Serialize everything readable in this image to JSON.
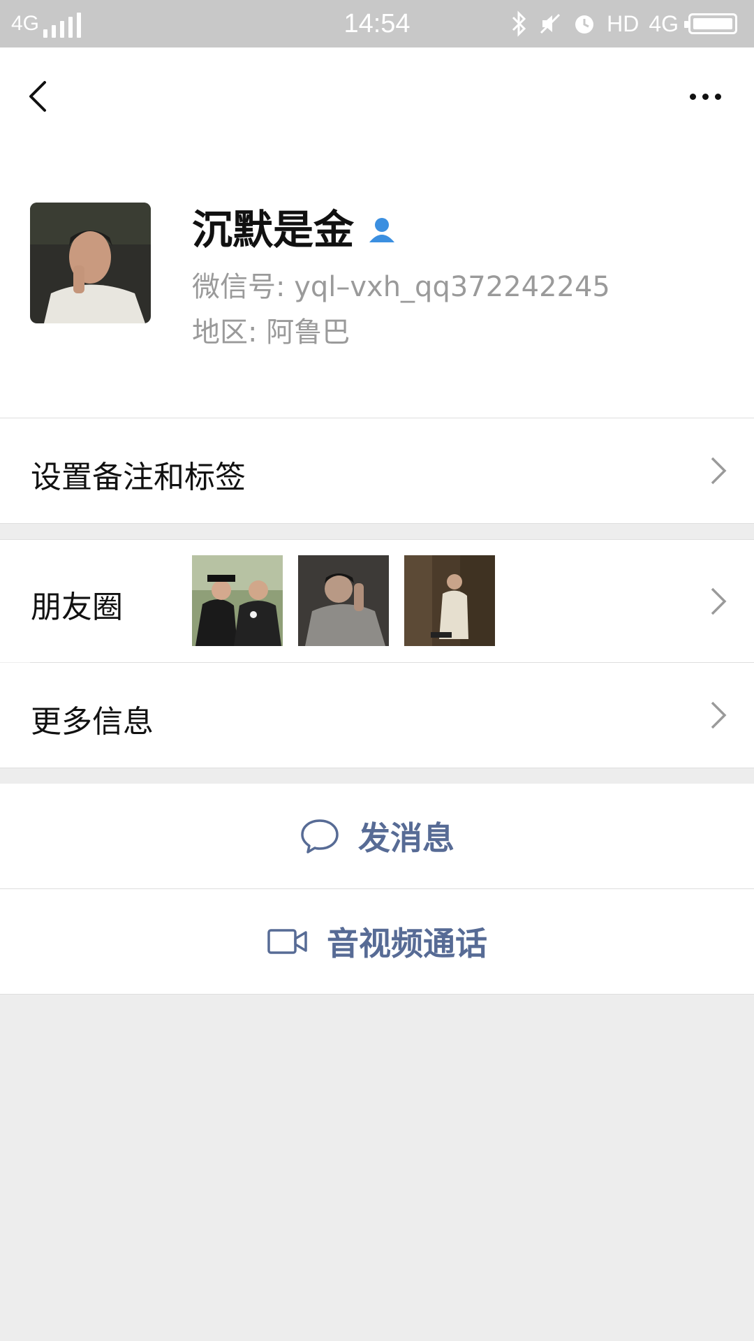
{
  "status_bar": {
    "network": "4G",
    "time": "14:54",
    "hd_label": "HD",
    "network_right": "4G"
  },
  "profile": {
    "name": "沉默是金",
    "wechat_id": "微信号: yql–vxh_qq372242245",
    "region": "地区: 阿鲁巴"
  },
  "menu": {
    "remarks_tags": "设置备注和标签",
    "moments": "朋友圈",
    "more_info": "更多信息"
  },
  "actions": {
    "send_message": "发消息",
    "video_call": "音视频通话"
  },
  "colors": {
    "link_blue": "#576b95",
    "gender_icon": "#3b8fe0",
    "status_bar_bg": "#c8c8c8"
  },
  "icons": [
    "back-arrow-icon",
    "more-dots-icon",
    "male-user-icon",
    "chevron-right-icon",
    "chat-bubble-icon",
    "video-camera-icon"
  ]
}
